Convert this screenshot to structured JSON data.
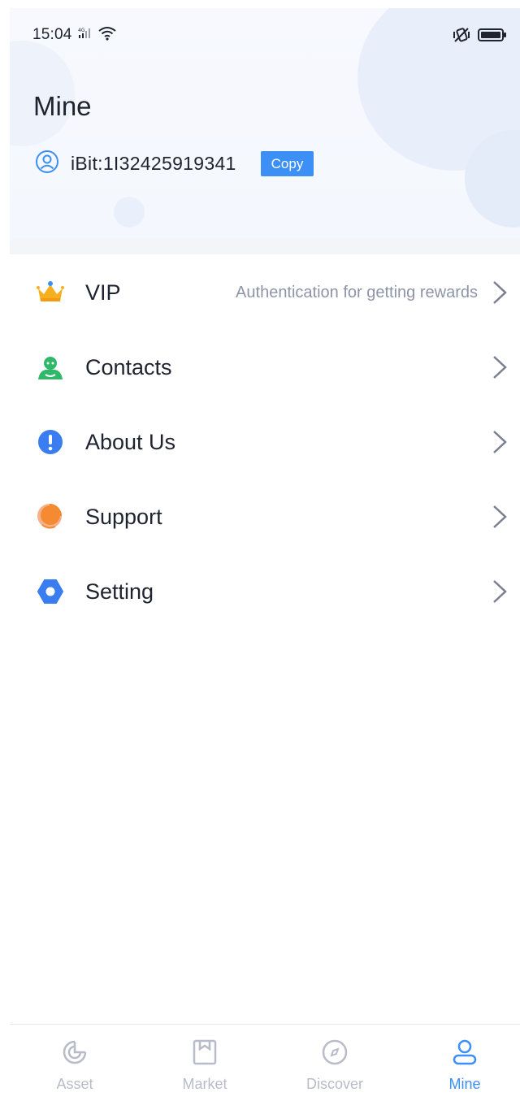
{
  "status_bar": {
    "time": "15:04"
  },
  "header": {
    "title": "Mine",
    "user_id": "iBit:1I32425919341",
    "copy_label": "Copy"
  },
  "menu": [
    {
      "label": "VIP",
      "subtitle": "Authentication for getting rewards",
      "icon": "crown-icon"
    },
    {
      "label": "Contacts",
      "subtitle": "",
      "icon": "contacts-icon"
    },
    {
      "label": "About Us",
      "subtitle": "",
      "icon": "info-icon"
    },
    {
      "label": "Support",
      "subtitle": "",
      "icon": "support-icon"
    },
    {
      "label": "Setting",
      "subtitle": "",
      "icon": "setting-icon"
    }
  ],
  "tabbar": {
    "tabs": [
      {
        "label": "Asset",
        "icon": "asset-icon",
        "active": false
      },
      {
        "label": "Market",
        "icon": "market-icon",
        "active": false
      },
      {
        "label": "Discover",
        "icon": "discover-icon",
        "active": false
      },
      {
        "label": "Mine",
        "icon": "mine-icon",
        "active": true
      }
    ]
  },
  "colors": {
    "accent": "#3b8ff5",
    "text": "#1f2330",
    "muted": "#8e94a8",
    "inactive_tab": "#b8bcc8"
  }
}
